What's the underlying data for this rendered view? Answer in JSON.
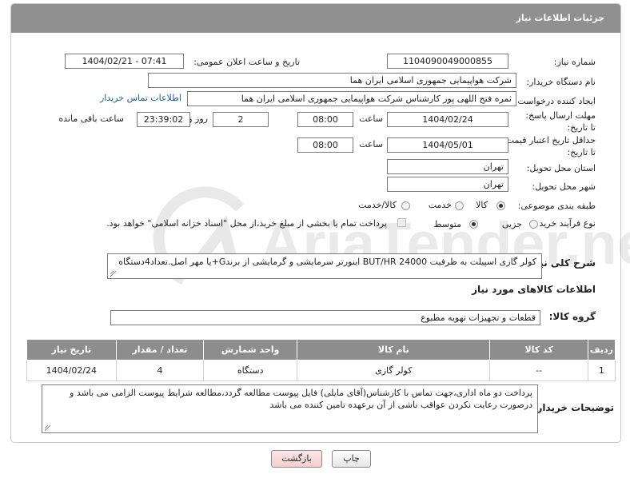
{
  "panel": {
    "title": "جزئیات اطلاعات نیاز"
  },
  "labels": {
    "need_number": "شماره نیاز:",
    "announce_datetime": "تاریخ و ساعت اعلان عمومی:",
    "buyer_org": "نام دستگاه خریدار:",
    "requester": "ایجاد کننده درخواست:",
    "reply_deadline": "مهلت ارسال پاسخ: تا تاریخ:",
    "price_validity": "حداقل تاریخ اعتبار قیمت: تا تاریخ:",
    "province": "استان محل تحویل:",
    "city": "شهر محل تحویل:",
    "category": "طبقه بندی موضوعی:",
    "purchase_type": "نوع فرآیند خرید :",
    "summary": "شرح کلی نیاز:",
    "goods_info": "اطلاعات کالاهای مورد نیاز",
    "goods_group": "گروه کالا:",
    "buyer_notes": "توضیحات خریدار:",
    "time": "ساعت",
    "days_and": "روز و",
    "remaining": "ساعت باقی مانده"
  },
  "fields": {
    "need_number": "1104090049000855",
    "announce_datetime": "1404/02/21 - 07:41",
    "buyer_org": "شرکت هواپیمایی جمهوری اسلامی ایران هما",
    "requester": "ثمره فتح اللهی پور کارشناس شرکت هواپیمایی جمهوری اسلامی ایران هما",
    "reply_date": "1404/02/24",
    "reply_time": "08:00",
    "reply_days": "2",
    "reply_remaining": "23:39:02",
    "validity_date": "1404/05/01",
    "validity_time": "08:00",
    "province": "تهران",
    "city": "تهران",
    "summary": "کولر گازی  اسپیلت به ظرفیت BUT/HR 24000 اینورتر سرمایشی و گرمایشی از برندG+یا مهر اصل.تعداد4دستگاه",
    "goods_group": "قطعات و تجهیزات تهویه مطبوع",
    "buyer_notes": "پرداخت دو ماه اداری،جهت تماس با کارشناس(آقای مایلی) فایل پیوست مطالعه گردد،مطالعه شرایط پیوست الزامی می باشد و درصورت رعایت نکردن عواقب ناشی از آن برعهده تامین کننده می باشد"
  },
  "links": {
    "buyer_contact": "اطلاعات تماس خریدار"
  },
  "category_options": {
    "goods": "کالا",
    "service": "خدمت",
    "goods_service": "کالا/خدمت",
    "selected": "کالا"
  },
  "purchase_options": {
    "minor": "جزیی",
    "medium": "متوسط",
    "selected": "متوسط"
  },
  "treasury_note": "پرداخت تمام یا بخشی از مبلغ خرید،از محل \"اسناد خزانه اسلامی\" خواهد بود.",
  "table": {
    "headers": {
      "row": "ردیف",
      "code": "کد کالا",
      "name": "نام کالا",
      "unit": "واحد شمارش",
      "qty": "تعداد / مقدار",
      "date": "تاریخ نیاز"
    },
    "rows": [
      {
        "row": "1",
        "code": "--",
        "name": "کولر گازی",
        "unit": "دستگاه",
        "qty": "4",
        "date": "1404/02/24"
      }
    ]
  },
  "buttons": {
    "print": "چاپ",
    "back": "بازگشت"
  },
  "watermark": "AriaTender.neT",
  "colors": {
    "header": "#909090",
    "link": "#1a5fb4",
    "back_button": "#f8d8d8"
  }
}
